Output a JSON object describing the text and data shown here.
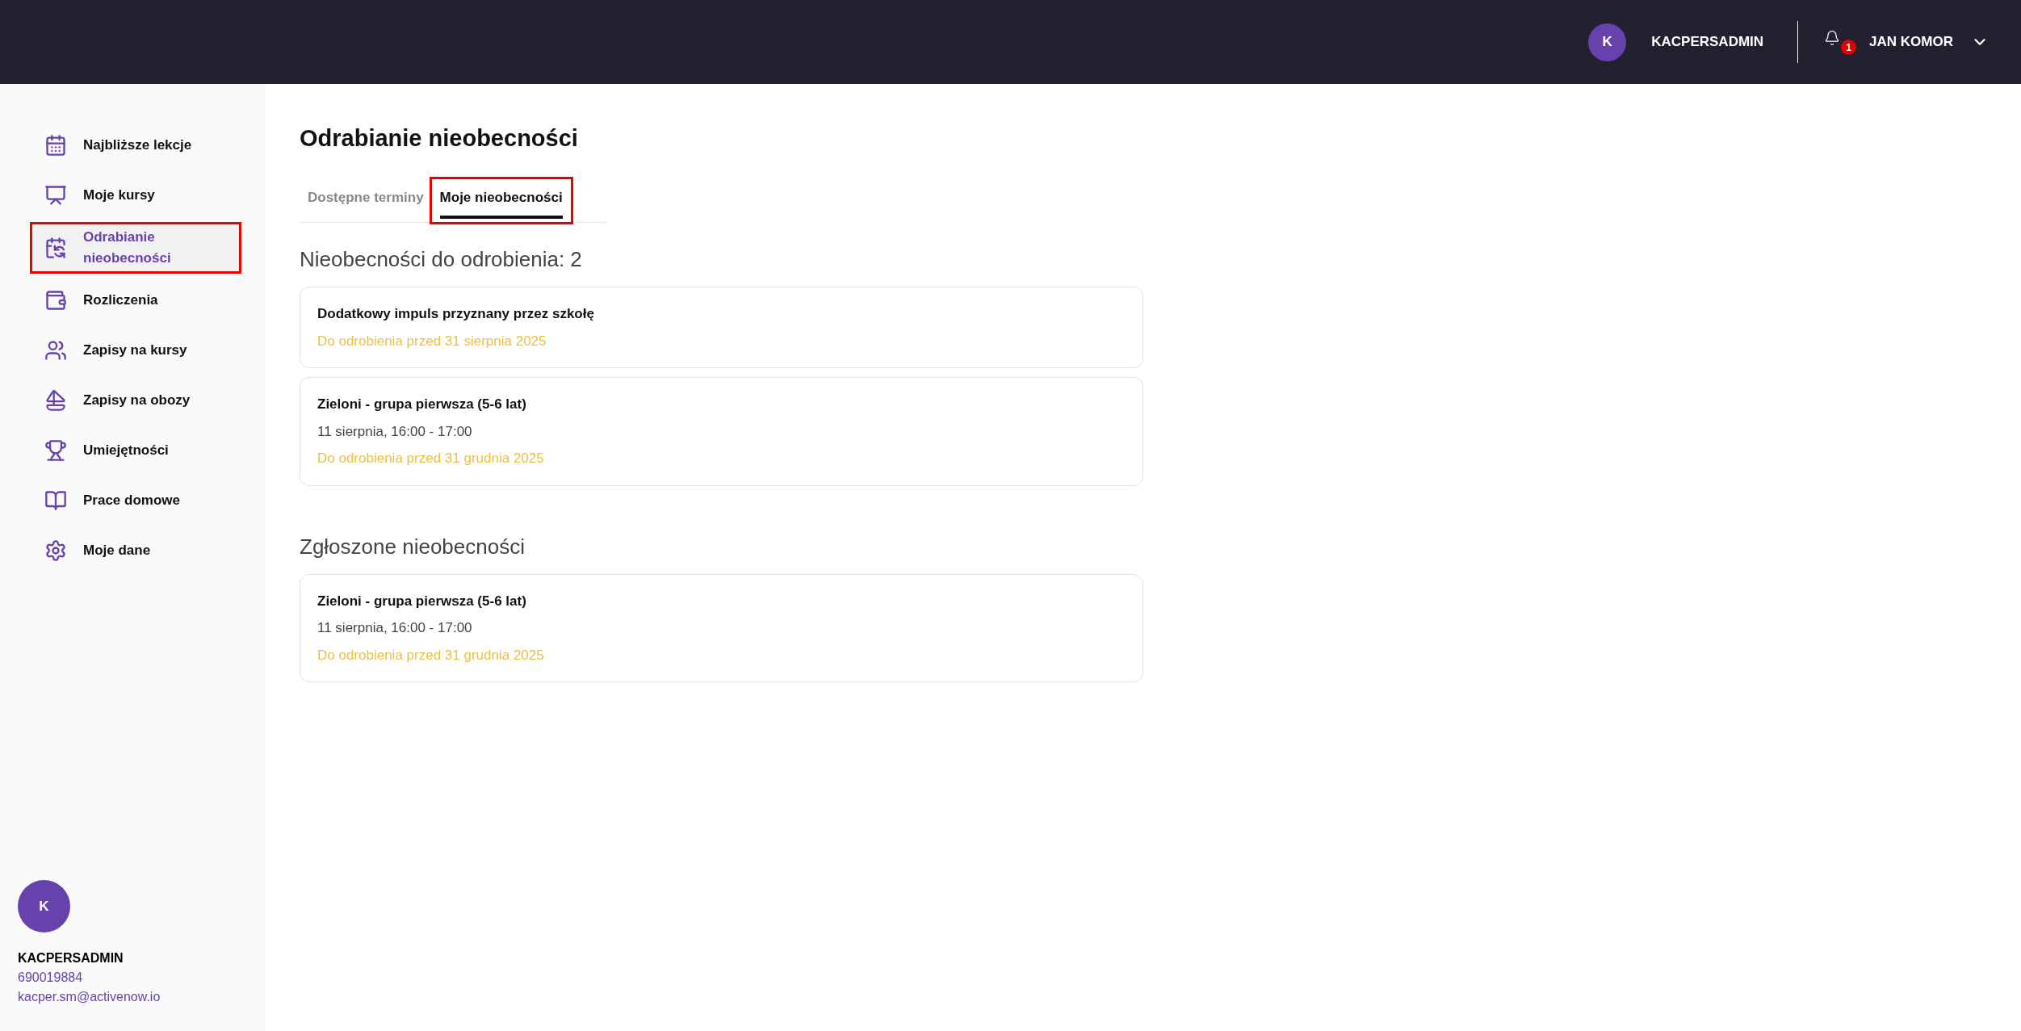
{
  "topbar": {
    "avatar_initial": "K",
    "username": "KACPERSADMIN",
    "notification_count": "1",
    "account_name": "JAN KOMOR"
  },
  "sidebar": {
    "items": [
      {
        "label": "Najbliższe lekcje",
        "selected": false,
        "highlighted": false
      },
      {
        "label": "Moje kursy",
        "selected": false,
        "highlighted": false
      },
      {
        "label": "Odrabianie nieobecności",
        "selected": true,
        "highlighted": true
      },
      {
        "label": "Rozliczenia",
        "selected": false,
        "highlighted": false
      },
      {
        "label": "Zapisy na kursy",
        "selected": false,
        "highlighted": false
      },
      {
        "label": "Zapisy na obozy",
        "selected": false,
        "highlighted": false
      },
      {
        "label": "Umiejętności",
        "selected": false,
        "highlighted": false
      },
      {
        "label": "Prace domowe",
        "selected": false,
        "highlighted": false
      },
      {
        "label": "Moje dane",
        "selected": false,
        "highlighted": false
      }
    ],
    "profile": {
      "avatar_initial": "K",
      "name": "KACPERSADMIN",
      "phone": "690019884",
      "email": "kacper.sm@activenow.io"
    }
  },
  "page": {
    "title": "Odrabianie nieobecności",
    "tabs": [
      {
        "label": "Dostępne terminy",
        "selected": false,
        "highlighted": false
      },
      {
        "label": "Moje nieobecności",
        "selected": true,
        "highlighted": true
      }
    ],
    "sections": [
      {
        "heading": "Nieobecności do odrobienia: 2",
        "cards": [
          {
            "title": "Dodatkowy impuls przyznany przez szkołę",
            "deadline": "Do odrobienia przed 31 sierpnia 2025"
          },
          {
            "title": "Zieloni - grupa pierwsza (5-6 lat)",
            "date": "11 sierpnia, 16:00 - 17:00",
            "deadline": "Do odrobienia przed 31 grudnia 2025"
          }
        ]
      },
      {
        "heading": "Zgłoszone nieobecności",
        "cards": [
          {
            "title": "Zieloni - grupa pierwsza (5-6 lat)",
            "date": "11 sierpnia, 16:00 - 17:00",
            "deadline": "Do odrobienia przed 31 grudnia 2025"
          }
        ]
      }
    ]
  }
}
